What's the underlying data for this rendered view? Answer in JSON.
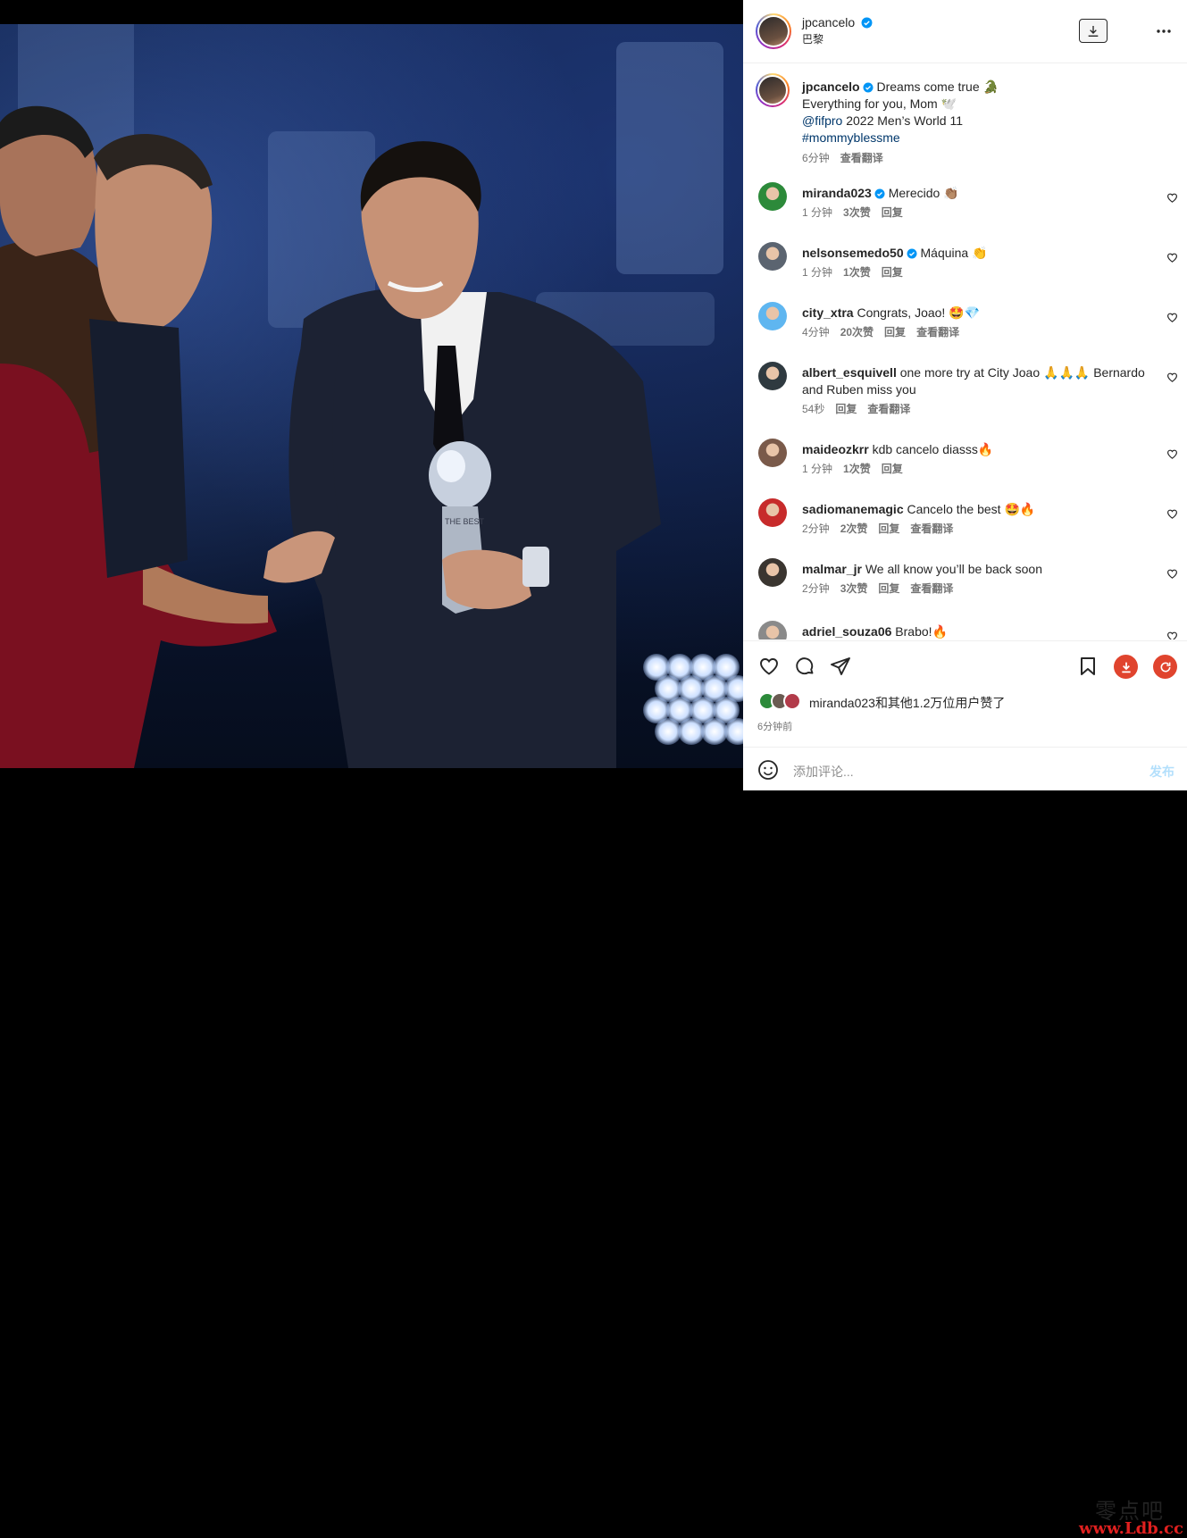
{
  "post": {
    "username": "jpcancelo",
    "location": "巴黎",
    "caption": {
      "username": "jpcancelo",
      "line1": "Dreams come true 🐊",
      "line2": "Everything for you, Mom 🕊️",
      "mention": "@fifpro",
      "line3_rest": " 2022 Men’s World 11",
      "hashtag": "#mommyblessme",
      "time": "6分钟",
      "translate": "查看翻译"
    },
    "trophy_text": "THE BEST"
  },
  "comments": [
    {
      "username": "miranda023",
      "verified": true,
      "text": "Merecido 👏🏽",
      "time": "1 分钟",
      "likes": "3次赞",
      "reply": "回复",
      "translate": "",
      "avatar_color": "#2c8a3a"
    },
    {
      "username": "nelsonsemedo50",
      "verified": true,
      "text": "Máquina 👏",
      "time": "1 分钟",
      "likes": "1次赞",
      "reply": "回复",
      "translate": "",
      "avatar_color": "#5b6470"
    },
    {
      "username": "city_xtra",
      "verified": false,
      "text": "Congrats, Joao! 🤩💎",
      "time": "4分钟",
      "likes": "20次赞",
      "reply": "回复",
      "translate": "查看翻译",
      "avatar_color": "#5fb6f0"
    },
    {
      "username": "albert_esquivell",
      "verified": false,
      "text": "one more try at City Joao 🙏🙏🙏 Bernardo and Ruben miss you",
      "time": "54秒",
      "likes": "",
      "reply": "回复",
      "translate": "查看翻译",
      "avatar_color": "#2f3a40"
    },
    {
      "username": "maideozkrr",
      "verified": false,
      "text": "kdb cancelo diasss🔥",
      "time": "1 分钟",
      "likes": "1次赞",
      "reply": "回复",
      "translate": "",
      "avatar_color": "#7a5a4a"
    },
    {
      "username": "sadiomanemagic",
      "verified": false,
      "text": "Cancelo the best 🤩🔥",
      "time": "2分钟",
      "likes": "2次赞",
      "reply": "回复",
      "translate": "查看翻译",
      "avatar_color": "#c72b2b"
    },
    {
      "username": "malmar_jr",
      "verified": false,
      "text": "We all know you’ll be back soon",
      "time": "2分钟",
      "likes": "3次赞",
      "reply": "回复",
      "translate": "查看翻译",
      "avatar_color": "#3a3530"
    },
    {
      "username": "adriel_souza06",
      "verified": false,
      "text": "Brabo!🔥",
      "time": "",
      "likes": "",
      "reply": "",
      "translate": "",
      "avatar_color": "#8a8a8a"
    }
  ],
  "footer": {
    "likes_text": "miranda023和其他1.2万位用户赞了",
    "time_ago": "6分钟前",
    "comment_placeholder": "添加评论...",
    "post_label": "发布"
  },
  "watermark": {
    "line1": "零点吧",
    "line2": "www.Ldb.cc"
  },
  "colors": {
    "verified": "#0095f6",
    "link": "#00376b",
    "meta": "#737373",
    "ext_download": "#e0442e",
    "ext_refresh": "#e0442e"
  },
  "icons": [
    "download-icon",
    "more-icon",
    "heart-icon",
    "comment-icon",
    "share-icon",
    "bookmark-icon",
    "emoji-icon",
    "verified-icon"
  ]
}
